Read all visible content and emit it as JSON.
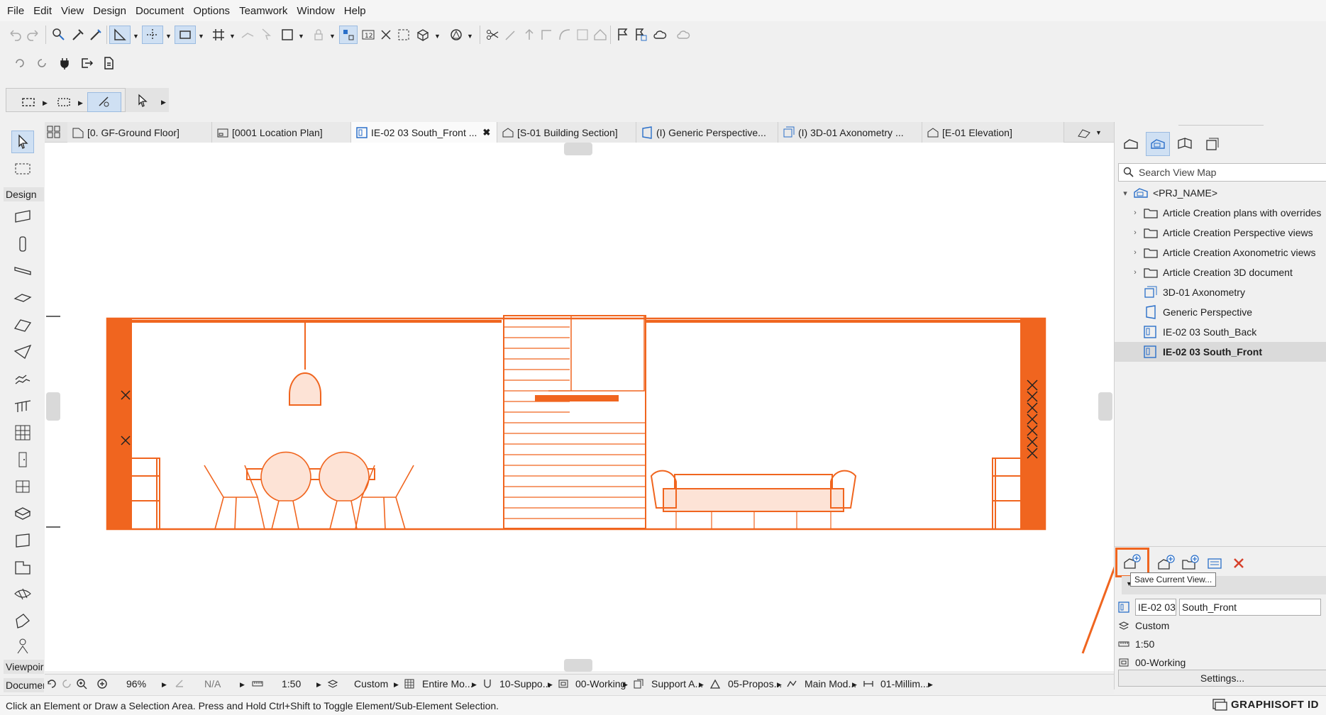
{
  "menu": [
    "File",
    "Edit",
    "View",
    "Design",
    "Document",
    "Options",
    "Teamwork",
    "Window",
    "Help"
  ],
  "tabs": [
    {
      "label": "[0. GF-Ground Floor]",
      "icon": "floor-plan-icon"
    },
    {
      "label": "[0001 Location Plan]",
      "icon": "layout-icon"
    },
    {
      "label": "IE-02 03 South_Front ...",
      "icon": "interior-elevation-icon",
      "active": true
    },
    {
      "label": "[S-01 Building Section]",
      "icon": "section-icon"
    },
    {
      "label": "(I) Generic Perspective...",
      "icon": "perspective-icon"
    },
    {
      "label": "(I) 3D-01 Axonometry ...",
      "icon": "axonometry-icon"
    },
    {
      "label": "[E-01 Elevation]",
      "icon": "elevation-icon"
    }
  ],
  "toolbox": {
    "design_label": "Design",
    "viewpoint_label": "Viewpoir",
    "document_label": "Documer"
  },
  "navigator": {
    "search_placeholder": "Search View Map",
    "tree": [
      {
        "label": "<PRJ_NAME>",
        "level": 0,
        "expand": "open",
        "icon": "project-icon"
      },
      {
        "label": "Article Creation plans with overrides",
        "level": 1,
        "expand": "closed",
        "icon": "folder-icon"
      },
      {
        "label": "Article Creation Perspective views",
        "level": 1,
        "expand": "closed",
        "icon": "folder-icon"
      },
      {
        "label": "Article Creation Axonometric views",
        "level": 1,
        "expand": "closed",
        "icon": "folder-icon"
      },
      {
        "label": "Article Creation 3D document",
        "level": 1,
        "expand": "closed",
        "icon": "folder-icon"
      },
      {
        "label": "3D-01 Axonometry",
        "level": 1,
        "expand": "none",
        "icon": "axonometry-icon"
      },
      {
        "label": "Generic Perspective",
        "level": 1,
        "expand": "none",
        "icon": "perspective-icon"
      },
      {
        "label": "IE-02 03 South_Back",
        "level": 1,
        "expand": "none",
        "icon": "interior-elevation-icon"
      },
      {
        "label": "IE-02 03 South_Front",
        "level": 1,
        "expand": "none",
        "icon": "interior-elevation-icon",
        "selected": true
      }
    ],
    "tooltip": "Save Current View...",
    "properties": {
      "id": "IE-02 03",
      "name": "South_Front",
      "layer_combo": "Custom",
      "scale": "1:50",
      "structure": "00-Working"
    },
    "settings_label": "Settings..."
  },
  "statusbar": {
    "zoom": "96%",
    "angle": "N/A",
    "scale": "1:50",
    "layers": "Custom",
    "model_view": "Entire Mo...",
    "pen_set": "10-Suppo...",
    "structure": "00-Working",
    "graphic_override": "Support A...",
    "renovation": "05-Propos...",
    "mvo": "Main Mod...",
    "dimension": "01-Millim..."
  },
  "hint": "Click an Element or Draw a Selection Area. Press and Hold Ctrl+Shift to Toggle Element/Sub-Element Selection.",
  "brand": "GRAPHISOFT ID",
  "colors": {
    "drawing": "#f0651f",
    "highlight": "#f0651f",
    "accent_blue": "#2a6fc9",
    "delete_red": "#d6402b"
  }
}
